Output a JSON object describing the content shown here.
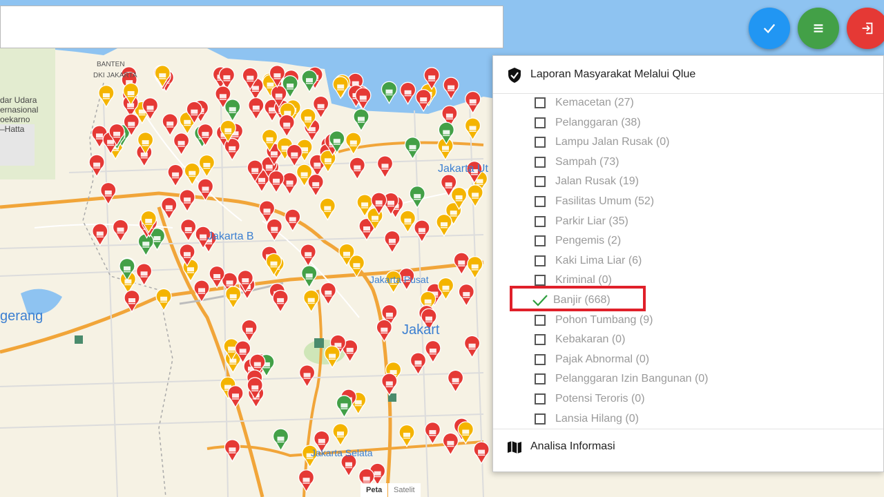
{
  "map": {
    "labels": {
      "jakarta_utara": "Jakarta Ut",
      "jakarta_barat": "Jakarta B",
      "jakarta_pusat": "Jakarta Pusat",
      "jakarta_timur": "Jakart",
      "jakarta_selatan": "Jakarta Selata",
      "tangerang": "gerang",
      "airport": "dar Udara\nernasional\noekarno\n–Hatta",
      "banten": "BANTEN",
      "dki_jakarta": "DKI JAKARTA"
    },
    "map_type_buttons": [
      "Peta",
      "Satelit"
    ],
    "marker_colors": {
      "red": "#e53935",
      "yellow": "#f4b400",
      "green": "#43a047"
    }
  },
  "search": {
    "value": "",
    "placeholder": ""
  },
  "fab": {
    "check": "check-icon",
    "menu": "menu-icon",
    "logout": "logout-icon"
  },
  "panel": {
    "title": "Laporan Masyarakat Melalui Qlue",
    "items": [
      {
        "label": "Kemacetan (27)",
        "checked": false
      },
      {
        "label": "Pelanggaran (38)",
        "checked": false
      },
      {
        "label": "Lampu Jalan Rusak (0)",
        "checked": false
      },
      {
        "label": "Sampah (73)",
        "checked": false
      },
      {
        "label": "Jalan Rusak (19)",
        "checked": false
      },
      {
        "label": "Fasilitas Umum (52)",
        "checked": false
      },
      {
        "label": "Parkir Liar (35)",
        "checked": false
      },
      {
        "label": "Pengemis (2)",
        "checked": false
      },
      {
        "label": "Kaki Lima Liar (6)",
        "checked": false
      },
      {
        "label": "Kriminal (0)",
        "checked": false
      },
      {
        "label": "Banjir (668)",
        "checked": true
      },
      {
        "label": "Pohon Tumbang (9)",
        "checked": false
      },
      {
        "label": "Kebakaran (0)",
        "checked": false
      },
      {
        "label": "Pajak Abnormal (0)",
        "checked": false
      },
      {
        "label": "Pelanggaran Izin Bangunan (0)",
        "checked": false
      },
      {
        "label": "Potensi Teroris (0)",
        "checked": false
      },
      {
        "label": "Lansia Hilang (0)",
        "checked": false
      }
    ],
    "footer_title": "Analisa Informasi",
    "highlight_color": "#e0202a"
  }
}
